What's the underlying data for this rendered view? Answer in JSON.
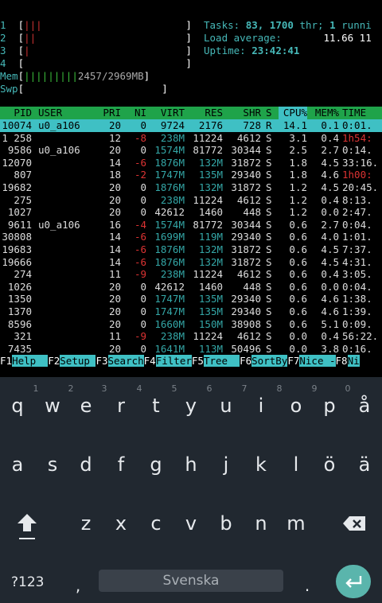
{
  "meters": {
    "cpu": [
      {
        "num": "1",
        "bar": "|||",
        "color": "red"
      },
      {
        "num": "2",
        "bar": "||",
        "color": "red"
      },
      {
        "num": "3",
        "bar": "|",
        "color": "red"
      },
      {
        "num": "4",
        "bar": "",
        "color": "red"
      }
    ],
    "mem": {
      "label": "Mem",
      "bar": "|||||||||",
      "value": "2457/2969MB"
    },
    "swp": {
      "label": "Swp",
      "bar": "",
      "value": ""
    }
  },
  "summary": {
    "tasks_label": "Tasks:",
    "tasks_count": "83,",
    "threads": "1700",
    "thr_label": "thr;",
    "running_count": "1",
    "running_label": "runni",
    "load_label": "Load average:",
    "load_value": "11.66 11",
    "uptime_label": "Uptime:",
    "uptime_value": "23:42:41"
  },
  "columns": [
    "PID",
    "USER",
    "PRI",
    "NI",
    "VIRT",
    "RES",
    "SHR",
    "S",
    "CPU%",
    "MEM%",
    "TIME"
  ],
  "processes": [
    {
      "pid": "10074",
      "user": "u0_a106",
      "pri": "20",
      "ni": "0",
      "virt": "9724",
      "res": "2176",
      "shr": "728",
      "s": "R",
      "cpu": "14.1",
      "mem": "0.1",
      "time": "0:01.",
      "selected": true
    },
    {
      "pid": "1 258",
      "user": "",
      "pri": "12",
      "ni": "-8",
      "virt": "238M",
      "res": "11224",
      "shr": "4612",
      "s": "S",
      "cpu": "3.1",
      "mem": "0.4",
      "time": "1h54:"
    },
    {
      "pid": "9586",
      "user": "u0_a106",
      "pri": "20",
      "ni": "0",
      "virt": "1574M",
      "res": "81772",
      "shr": "30344",
      "s": "S",
      "cpu": "2.5",
      "mem": "2.7",
      "time": "0:14."
    },
    {
      "pid": "12070",
      "user": "",
      "pri": "14",
      "ni": "-6",
      "virt": "1876M",
      "res": "132M",
      "shr": "31872",
      "s": "S",
      "cpu": "1.8",
      "mem": "4.5",
      "time": "33:16."
    },
    {
      "pid": "807",
      "user": "",
      "pri": "18",
      "ni": "-2",
      "virt": "1747M",
      "res": "135M",
      "shr": "29340",
      "s": "S",
      "cpu": "1.8",
      "mem": "4.6",
      "time": "1h00:"
    },
    {
      "pid": "19682",
      "user": "",
      "pri": "20",
      "ni": "0",
      "virt": "1876M",
      "res": "132M",
      "shr": "31872",
      "s": "S",
      "cpu": "1.2",
      "mem": "4.5",
      "time": "20:45."
    },
    {
      "pid": "275",
      "user": "",
      "pri": "20",
      "ni": "0",
      "virt": "238M",
      "res": "11224",
      "shr": "4612",
      "s": "S",
      "cpu": "1.2",
      "mem": "0.4",
      "time": "8:13."
    },
    {
      "pid": "1027",
      "user": "",
      "pri": "20",
      "ni": "0",
      "virt": "42612",
      "res": "1460",
      "shr": "448",
      "s": "S",
      "cpu": "1.2",
      "mem": "0.0",
      "time": "2:47."
    },
    {
      "pid": "9611",
      "user": "u0_a106",
      "pri": "16",
      "ni": "-4",
      "virt": "1574M",
      "res": "81772",
      "shr": "30344",
      "s": "S",
      "cpu": "0.6",
      "mem": "2.7",
      "time": "0:04."
    },
    {
      "pid": "30808",
      "user": "",
      "pri": "14",
      "ni": "-6",
      "virt": "1699M",
      "res": "119M",
      "shr": "29340",
      "s": "S",
      "cpu": "0.6",
      "mem": "4.0",
      "time": "1:01."
    },
    {
      "pid": "19683",
      "user": "",
      "pri": "14",
      "ni": "-6",
      "virt": "1876M",
      "res": "132M",
      "shr": "31872",
      "s": "S",
      "cpu": "0.6",
      "mem": "4.5",
      "time": "7:37."
    },
    {
      "pid": "19666",
      "user": "",
      "pri": "14",
      "ni": "-6",
      "virt": "1876M",
      "res": "132M",
      "shr": "31872",
      "s": "S",
      "cpu": "0.6",
      "mem": "4.5",
      "time": "4:31."
    },
    {
      "pid": "274",
      "user": "",
      "pri": "11",
      "ni": "-9",
      "virt": "238M",
      "res": "11224",
      "shr": "4612",
      "s": "S",
      "cpu": "0.6",
      "mem": "0.4",
      "time": "3:05."
    },
    {
      "pid": "1026",
      "user": "",
      "pri": "20",
      "ni": "0",
      "virt": "42612",
      "res": "1460",
      "shr": "448",
      "s": "S",
      "cpu": "0.6",
      "mem": "0.0",
      "time": "0:04."
    },
    {
      "pid": "1350",
      "user": "",
      "pri": "20",
      "ni": "0",
      "virt": "1747M",
      "res": "135M",
      "shr": "29340",
      "s": "S",
      "cpu": "0.6",
      "mem": "4.6",
      "time": "1:38."
    },
    {
      "pid": "1370",
      "user": "",
      "pri": "20",
      "ni": "0",
      "virt": "1747M",
      "res": "135M",
      "shr": "29340",
      "s": "S",
      "cpu": "0.6",
      "mem": "4.6",
      "time": "1:39."
    },
    {
      "pid": "8596",
      "user": "",
      "pri": "20",
      "ni": "0",
      "virt": "1660M",
      "res": "150M",
      "shr": "38908",
      "s": "S",
      "cpu": "0.6",
      "mem": "5.1",
      "time": "0:09."
    },
    {
      "pid": "321",
      "user": "",
      "pri": "11",
      "ni": "-9",
      "virt": "238M",
      "res": "11224",
      "shr": "4612",
      "s": "S",
      "cpu": "0.0",
      "mem": "0.4",
      "time": "56:22."
    },
    {
      "pid": "7435",
      "user": "",
      "pri": "20",
      "ni": "0",
      "virt": "1641M",
      "res": "113M",
      "shr": "50496",
      "s": "S",
      "cpu": "0.0",
      "mem": "3.8",
      "time": "0:16."
    }
  ],
  "fkeys": [
    {
      "num": "F1",
      "label": "Help  "
    },
    {
      "num": "F2",
      "label": "Setup "
    },
    {
      "num": "F3",
      "label": "Search"
    },
    {
      "num": "F4",
      "label": "Filter"
    },
    {
      "num": "F5",
      "label": "Tree  "
    },
    {
      "num": "F6",
      "label": "SortBy"
    },
    {
      "num": "F7",
      "label": "Nice -"
    },
    {
      "num": "F8",
      "label": "Ni"
    }
  ],
  "keyboard": {
    "hints": [
      "1",
      "2",
      "3",
      "4",
      "5",
      "6",
      "7",
      "8",
      "9",
      "0"
    ],
    "row1": [
      "q",
      "w",
      "e",
      "r",
      "t",
      "y",
      "u",
      "i",
      "o",
      "p",
      "å"
    ],
    "row2": [
      "a",
      "s",
      "d",
      "f",
      "g",
      "h",
      "j",
      "k",
      "l",
      "ö",
      "ä"
    ],
    "row3": [
      "z",
      "x",
      "c",
      "v",
      "b",
      "n",
      "m"
    ],
    "symbols_label": "?123",
    "comma": ",",
    "period": ".",
    "space_label": "Svenska"
  }
}
